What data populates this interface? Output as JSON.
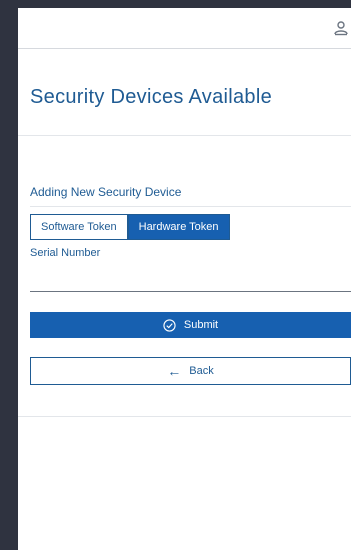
{
  "header": {
    "title": "Security Devices Available"
  },
  "form": {
    "section_title": "Adding New Security Device",
    "tabs": [
      {
        "label": "Software Token",
        "active": false
      },
      {
        "label": "Hardware Token",
        "active": true
      }
    ],
    "serial_label": "Serial Number",
    "serial_value": "",
    "serial_placeholder": "",
    "submit_label": "Submit",
    "back_label": "Back"
  },
  "icons": {
    "user": "user-icon",
    "submit": "check-circle-icon",
    "back": "arrow-left-icon"
  },
  "colors": {
    "accent": "#1760b0",
    "text_primary": "#1f5b93",
    "frame": "#2f3340"
  }
}
